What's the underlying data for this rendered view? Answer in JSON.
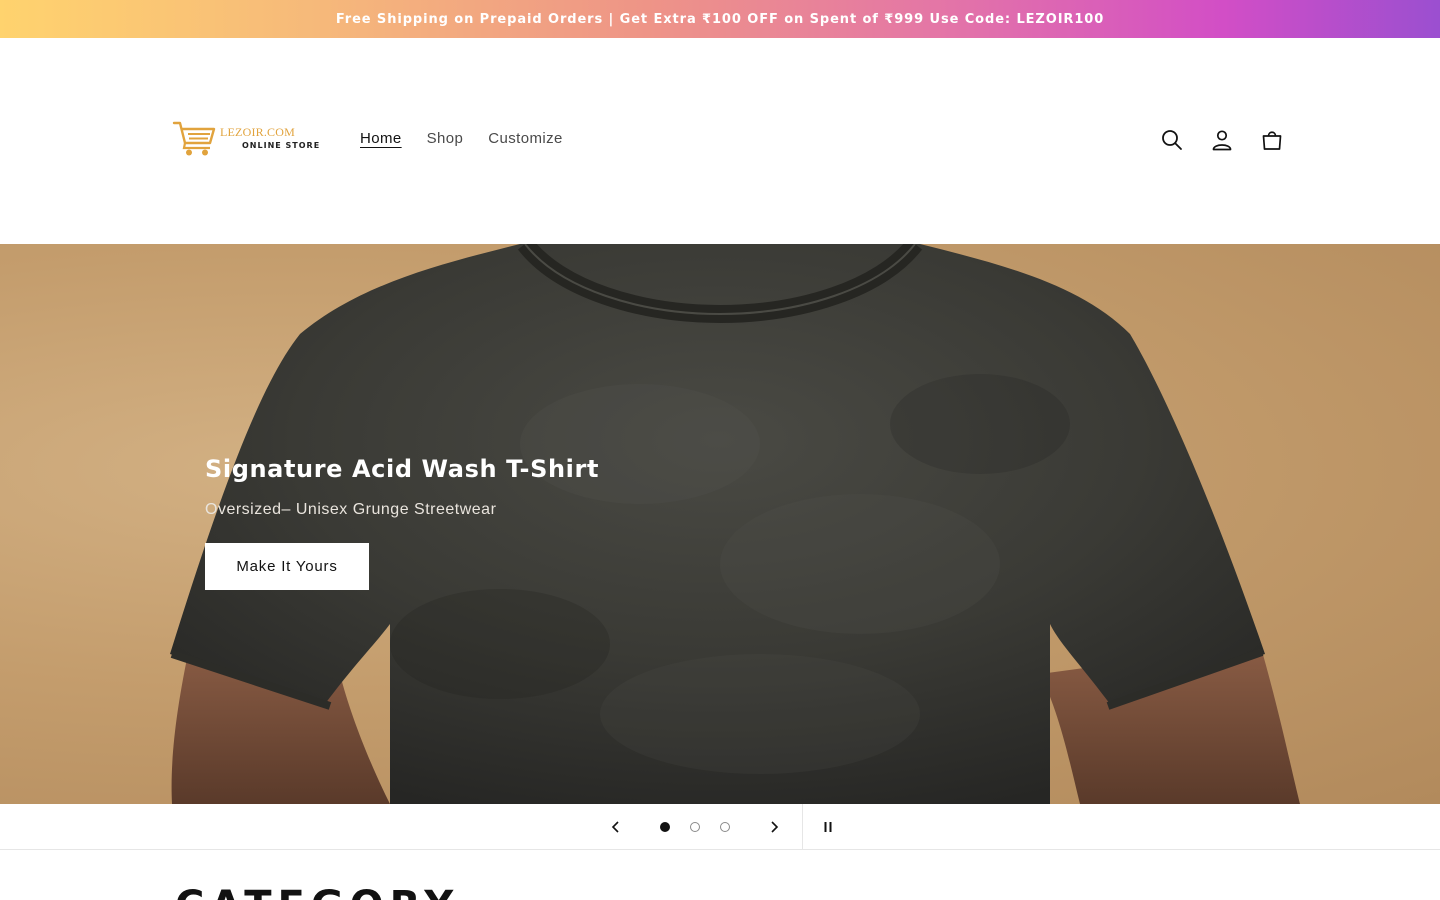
{
  "announcement": {
    "text": "Free Shipping on Prepaid Orders | Get Extra ₹100 OFF on Spent of ₹999 Use Code: LEZOIR100"
  },
  "header": {
    "logo": {
      "brand": "LEZOIR.COM",
      "tagline": "ONLINE STORE",
      "icon": "shopping-cart-icon",
      "color": "#E1A33D"
    },
    "nav": [
      {
        "label": "Home",
        "active": true
      },
      {
        "label": "Shop",
        "active": false
      },
      {
        "label": "Customize",
        "active": false
      }
    ],
    "icons": [
      "search-icon",
      "account-icon",
      "cart-icon"
    ]
  },
  "hero": {
    "title": "Signature Acid Wash T-Shirt",
    "subtitle": "Oversized– Unisex Grunge Streetwear",
    "button_label": "Make It Yours"
  },
  "slider": {
    "slide_count": 3,
    "current_slide": 1,
    "controls": [
      "previous-slide-icon",
      "next-slide-icon",
      "pause-icon"
    ]
  },
  "section": {
    "heading": "CATEGORY"
  }
}
